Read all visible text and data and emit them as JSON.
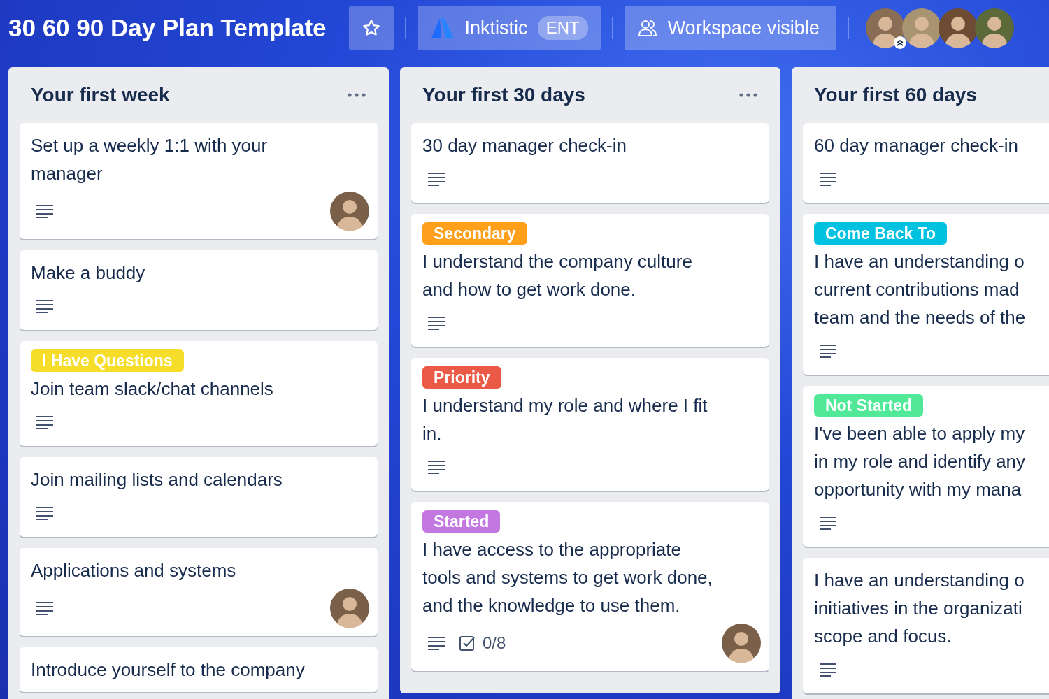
{
  "header": {
    "title": "30 60 90 Day Plan Template",
    "workspace": {
      "name": "Inktistic",
      "badge": "ENT"
    },
    "visibility": "Workspace visible",
    "members": [
      {
        "admin": true
      },
      {
        "admin": false
      },
      {
        "admin": false
      },
      {
        "admin": false
      }
    ]
  },
  "lists": [
    {
      "title": "Your first week",
      "menu": true,
      "cards": [
        {
          "lines": [
            "Set up a weekly 1:1 with your",
            "manager"
          ],
          "description": true,
          "member": true
        },
        {
          "lines": [
            "Make a buddy"
          ],
          "description": true,
          "member": false
        },
        {
          "labels": [
            {
              "text": "I Have Questions",
              "color": "#f5dd29"
            }
          ],
          "lines": [
            "Join team slack/chat channels"
          ],
          "description": true,
          "member": false
        },
        {
          "lines": [
            "Join mailing lists and calendars"
          ],
          "description": true,
          "member": false
        },
        {
          "lines": [
            "Applications and systems"
          ],
          "description": true,
          "member": true
        },
        {
          "lines": [
            "Introduce yourself to the company"
          ],
          "description": false,
          "member": false
        }
      ]
    },
    {
      "title": "Your first 30 days",
      "menu": true,
      "cards": [
        {
          "lines": [
            "30 day manager check-in"
          ],
          "description": true,
          "member": false
        },
        {
          "labels": [
            {
              "text": "Secondary",
              "color": "#ff9f1a"
            }
          ],
          "lines": [
            "I understand the company culture",
            "and how to get work done."
          ],
          "description": true,
          "member": false
        },
        {
          "labels": [
            {
              "text": "Priority",
              "color": "#eb5a46"
            }
          ],
          "lines": [
            "I understand my role and where I fit",
            "in."
          ],
          "description": true,
          "member": false
        },
        {
          "labels": [
            {
              "text": "Started",
              "color": "#c377e0"
            }
          ],
          "lines": [
            "I have access to the appropriate",
            "tools and systems to get work done,",
            "and the knowledge to use them."
          ],
          "description": true,
          "checklist": "0/8",
          "member": true
        }
      ]
    },
    {
      "title": "Your first 60 days",
      "menu": false,
      "cards": [
        {
          "lines": [
            "60 day manager check-in"
          ],
          "description": true,
          "member": false
        },
        {
          "labels": [
            {
              "text": "Come Back To",
              "color": "#00c2e0"
            }
          ],
          "lines": [
            "I have an understanding o",
            "current contributions mad",
            "team and the needs of the"
          ],
          "description": true,
          "member": false
        },
        {
          "labels": [
            {
              "text": "Not Started",
              "color": "#51e898"
            }
          ],
          "lines": [
            "I've been able to apply my",
            "in my role and identify any",
            "opportunity with my mana"
          ],
          "description": true,
          "member": false
        },
        {
          "lines": [
            "I have an understanding o",
            "initiatives in the organizati",
            "scope and focus."
          ],
          "description": true,
          "member": false
        }
      ]
    }
  ]
}
